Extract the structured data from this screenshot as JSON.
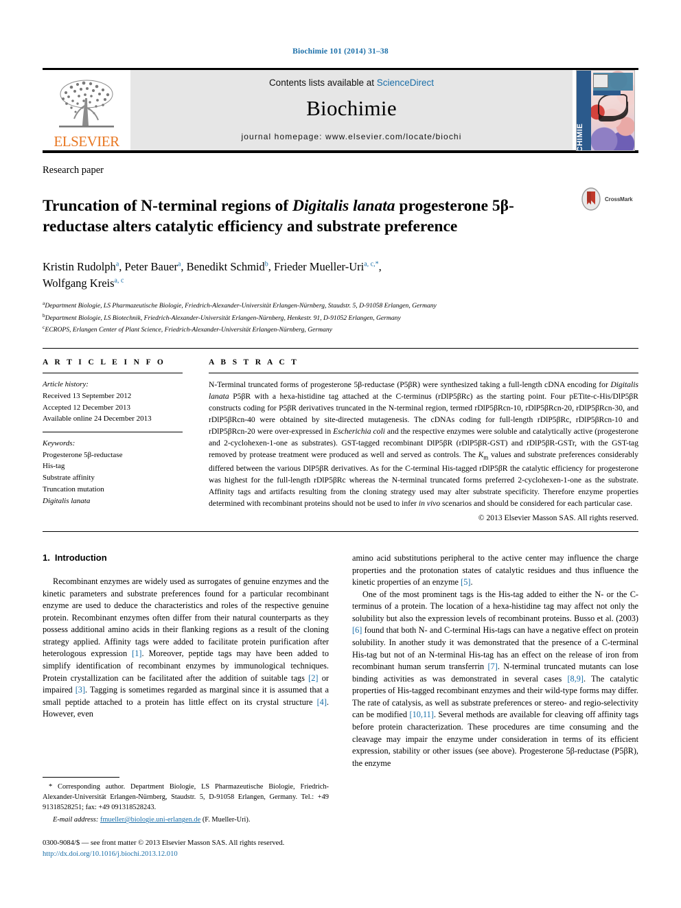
{
  "running_head": "Biochimie 101 (2014) 31–38",
  "masthead": {
    "publisher_name": "ELSEVIER",
    "contents_prefix": "Contents lists available at ",
    "contents_link": "ScienceDirect",
    "journal_title": "Biochimie",
    "homepage": "journal homepage: www.elsevier.com/locate/biochi",
    "cover_spine_text": "BIOCHIMIE"
  },
  "article": {
    "type": "Research paper",
    "title_part1": "Truncation of N-terminal regions of ",
    "title_italic": "Digitalis lanata",
    "title_part2": " progesterone 5β-reductase alters catalytic efficiency and substrate preference",
    "crossmark_label": "CrossMark",
    "authors": [
      {
        "name": "Kristin Rudolph",
        "sup": "a",
        "sep": ", "
      },
      {
        "name": "Peter Bauer",
        "sup": "a",
        "sep": ", "
      },
      {
        "name": "Benedikt Schmid",
        "sup": "b",
        "sep": ", "
      },
      {
        "name": "Frieder Mueller-Uri",
        "sup": "a, c,*",
        "sep": ", "
      },
      {
        "name": "Wolfgang Kreis",
        "sup": "a, c",
        "sep": ""
      }
    ],
    "affiliations": [
      {
        "marker": "a",
        "text": "Department Biologie, LS Pharmazeutische Biologie, Friedrich-Alexander-Universität Erlangen-Nürnberg, Staudstr. 5, D-91058 Erlangen, Germany"
      },
      {
        "marker": "b",
        "text": "Department Biologie, LS Biotechnik, Friedrich-Alexander-Universität Erlangen-Nürnberg, Henkestr. 91, D-91052 Erlangen, Germany"
      },
      {
        "marker": "c",
        "text": "ECROPS, Erlangen Center of Plant Science, Friedrich-Alexander-Universität Erlangen-Nürnberg, Germany"
      }
    ]
  },
  "article_info": {
    "heading": "A R T I C L E    I N F O",
    "history_label": "Article history:",
    "history": [
      "Received 13 September 2012",
      "Accepted 12 December 2013",
      "Available online 24 December 2013"
    ],
    "keywords_label": "Keywords:",
    "keywords": [
      "Progesterone 5β-reductase",
      "His-tag",
      "Substrate affinity",
      "Truncation mutation"
    ],
    "keyword_italic": "Digitalis lanata"
  },
  "abstract": {
    "heading": "A B S T R A C T",
    "p1_a": "N-Terminal truncated forms of progesterone 5β-reductase (P5βR) were synthesized taking a full-length cDNA encoding for ",
    "p1_italic1": "Digitalis lanata",
    "p1_b": " P5βR with a hexa-histidine tag attached at the C-terminus (rDlP5βRc) as the starting point. Four pETite-c-His/DlP5βR constructs coding for P5βR derivatives truncated in the N-terminal region, termed rDlP5βRcn-10, rDlP5βRcn-20, rDlP5βRcn-30, and rDlP5βRcn-40 were obtained by site-directed mutagenesis. The cDNAs coding for full-length rDlP5βRc, rDlP5βRcn-10 and rDlP5βRcn-20 were over-expressed in ",
    "p1_italic2": "Escherichia coli",
    "p1_c": " and the respective enzymes were soluble and catalytically active (progesterone and 2-cyclohexen-1-one as substrates). GST-tagged recombinant DlP5βR (rDlP5βR-GST) and rDlP5βR-GSTr, with the GST-tag removed by protease treatment were produced as well and served as controls. The ",
    "p1_km": "K",
    "p1_km_sub": "m",
    "p1_d": " values and substrate preferences considerably differed between the various DlP5βR derivatives. As for the C-terminal His-tagged rDlP5βR the catalytic efficiency for progesterone was highest for the full-length rDlP5βRc whereas the N-terminal truncated forms preferred 2-cyclohexen-1-one as the substrate. Affinity tags and artifacts resulting from the cloning strategy used may alter substrate specificity. Therefore enzyme properties determined with recombinant proteins should not be used to infer ",
    "p1_italic3": "in vivo",
    "p1_e": " scenarios and should be considered for each particular case.",
    "copyright": "© 2013 Elsevier Masson SAS. All rights reserved."
  },
  "intro": {
    "number": "1.",
    "heading": "Introduction",
    "left_p1": "Recombinant enzymes are widely used as surrogates of genuine enzymes and the kinetic parameters and substrate preferences found for a particular recombinant enzyme are used to deduce the characteristics and roles of the respective genuine protein. Recombinant enzymes often differ from their natural counterparts as they possess additional amino acids in their flanking regions as a result of the cloning strategy applied. Affinity tags were added to facilitate protein purification after heterologous expression ",
    "ref1": "[1]",
    "left_p1b": ". Moreover, peptide tags may have been added to simplify identification of recombinant enzymes by immunological techniques. Protein crystallization can be facilitated after the addition of suitable tags ",
    "ref2": "[2]",
    "left_p1c": " or impaired ",
    "ref3": "[3]",
    "left_p1d": ". Tagging is sometimes regarded as marginal since it is assumed that a small peptide attached to a protein has little effect on its crystal structure ",
    "ref4": "[4]",
    "left_p1e": ". However, even",
    "right_p0": "amino acid substitutions peripheral to the active center may influence the charge properties and the protonation states of catalytic residues and thus influence the kinetic properties of an enzyme ",
    "ref5": "[5]",
    "right_p0b": ".",
    "right_p1a": "One of the most prominent tags is the His-tag added to either the N- or the C-terminus of a protein. The location of a hexa-histidine tag may affect not only the solubility but also the expression levels of recombinant proteins. Busso et al. (2003) ",
    "ref6": "[6]",
    "right_p1b": " found that both N- and C-terminal His-tags can have a negative effect on protein solubility. In another study it was demonstrated that the presence of a C-terminal His-tag but not of an N-terminal His-tag has an effect on the release of iron from recombinant human serum transferrin ",
    "ref7": "[7]",
    "right_p1c": ". N-terminal truncated mutants can lose binding activities as was demonstrated in several cases ",
    "ref89": "[8,9]",
    "right_p1d": ". The catalytic properties of His-tagged recombinant enzymes and their wild-type forms may differ. The rate of catalysis, as well as substrate preferences or stereo- and regio-selectivity can be modified ",
    "ref1011": "[10,11]",
    "right_p1e": ". Several methods are available for cleaving off affinity tags before protein characterization. These procedures are time consuming and the cleavage may impair the enzyme under consideration in terms of its efficient expression, stability or other issues (see above). Progesterone 5β-reductase (P5βR), the enzyme"
  },
  "footnote": {
    "star_text": "* Corresponding author. Department Biologie, LS Pharmazeutische Biologie, Friedrich-Alexander-Universität Erlangen-Nürnberg, Staudstr. 5, D-91058 Erlangen, Germany. Tel.: +49 91318528251; fax: +49 091318528243.",
    "email_label": "E-mail address:",
    "email": "fmueller@biologie.uni-erlangen.de",
    "email_owner": "(F. Mueller-Uri)."
  },
  "page_footer": {
    "line1": "0300-9084/$ — see front matter © 2013 Elsevier Masson SAS. All rights reserved.",
    "line2": "http://dx.doi.org/10.1016/j.biochi.2013.12.010"
  },
  "colors": {
    "link": "#1a6ea8",
    "elsevier_orange": "#E87722",
    "masthead_gray": "#e6e6e6"
  }
}
